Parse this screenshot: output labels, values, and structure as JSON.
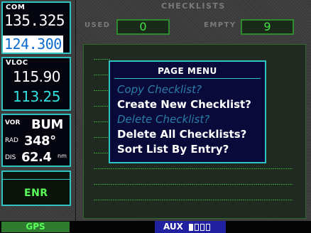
{
  "com": {
    "label": "COM",
    "active": "135.325",
    "standby": "124.300"
  },
  "vloc": {
    "label": "VLOC",
    "active": "115.90",
    "standby": "113.25"
  },
  "vor": {
    "label": "VOR",
    "ident": "BUM",
    "rad_label": "RAD",
    "radial": "348°",
    "dis_label": "DIS",
    "distance": "62.4",
    "distance_unit": "nm"
  },
  "cdi_mode": "ENR",
  "header": {
    "title": "CHECKLISTS",
    "used_label": "USED",
    "used_value": "0",
    "empty_label": "EMPTY",
    "empty_value": "9"
  },
  "menu": {
    "title": "PAGE MENU",
    "items": [
      {
        "label": "Copy Checklist?",
        "enabled": false
      },
      {
        "label": "Create New Checklist?",
        "enabled": true
      },
      {
        "label": "Delete Checklist?",
        "enabled": false
      },
      {
        "label": "Delete All Checklists?",
        "enabled": true
      },
      {
        "label": "Sort List By Entry?",
        "enabled": true
      }
    ]
  },
  "status_bar": {
    "mode": "GPS",
    "page_group": "AUX",
    "page_count": 4,
    "current_page": 1
  },
  "colors": {
    "cyan": "#2ec4c4",
    "green": "#44e044",
    "menu_bg": "#0a0a3a",
    "aux_bg": "#2020a0"
  }
}
